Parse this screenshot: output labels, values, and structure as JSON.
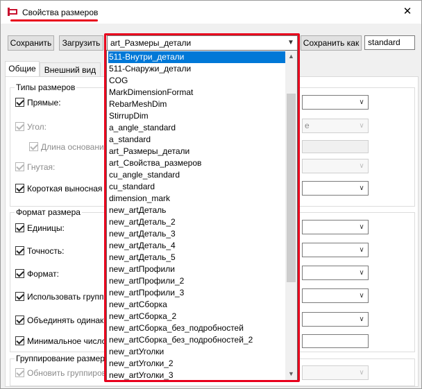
{
  "window": {
    "title": "Свойства размеров",
    "close_glyph": "✕"
  },
  "toolbar": {
    "save_label": "Сохранить",
    "load_label": "Загрузить",
    "preset_value": "art_Размеры_детали",
    "save_as_label": "Сохранить как",
    "save_as_name": "standard"
  },
  "tabs": [
    {
      "label": "Общие"
    },
    {
      "label": "Внешний вид"
    }
  ],
  "groups": {
    "types": "Типы размеров",
    "format": "Формат размера",
    "grouping": "Группирование размер"
  },
  "settings": [
    {
      "label": "Прямые:",
      "checked": true,
      "enabled": true
    },
    {
      "label": "Угол:",
      "checked": true,
      "enabled": false
    },
    {
      "label": "Длина основани",
      "checked": true,
      "enabled": false
    },
    {
      "label": "Гнутая:",
      "checked": true,
      "enabled": false
    },
    {
      "label": "Короткая выносная л",
      "checked": true,
      "enabled": true
    },
    {
      "label": "Единицы:",
      "checked": true,
      "enabled": true
    },
    {
      "label": "Точность:",
      "checked": true,
      "enabled": true
    },
    {
      "label": "Формат:",
      "checked": true,
      "enabled": true
    },
    {
      "label": "Использовать группи",
      "checked": true,
      "enabled": true
    },
    {
      "label": "Объединять одинако",
      "checked": true,
      "enabled": true
    },
    {
      "label": "Минимальное число",
      "checked": true,
      "enabled": true
    },
    {
      "label": "Обновить группирова",
      "checked": true,
      "enabled": false
    }
  ],
  "right_partial_text": "e",
  "dropdown": {
    "items": [
      "511-Внутри_детали",
      "511-Снаружи_детали",
      "COG",
      "MarkDimensionFormat",
      "RebarMeshDim",
      "StirrupDim",
      "a_angle_standard",
      "a_standard",
      "art_Размеры_детали",
      "art_Свойства_размеров",
      "cu_angle_standard",
      "cu_standard",
      "dimension_mark",
      "new_artДеталь",
      "new_artДеталь_2",
      "new_artДеталь_3",
      "new_artДеталь_4",
      "new_artДеталь_5",
      "new_artПрофили",
      "new_artПрофили_2",
      "new_artПрофили_3",
      "new_artСборка",
      "new_artСборка_2",
      "new_artСборка_без_подробностей",
      "new_artСборка_без_подробностей_2",
      "new_artУголки",
      "new_artУголки_2",
      "new_artУголки_3"
    ],
    "selected_index": 0
  },
  "colors": {
    "highlight": "#e8001c",
    "selection": "#0078d7"
  }
}
